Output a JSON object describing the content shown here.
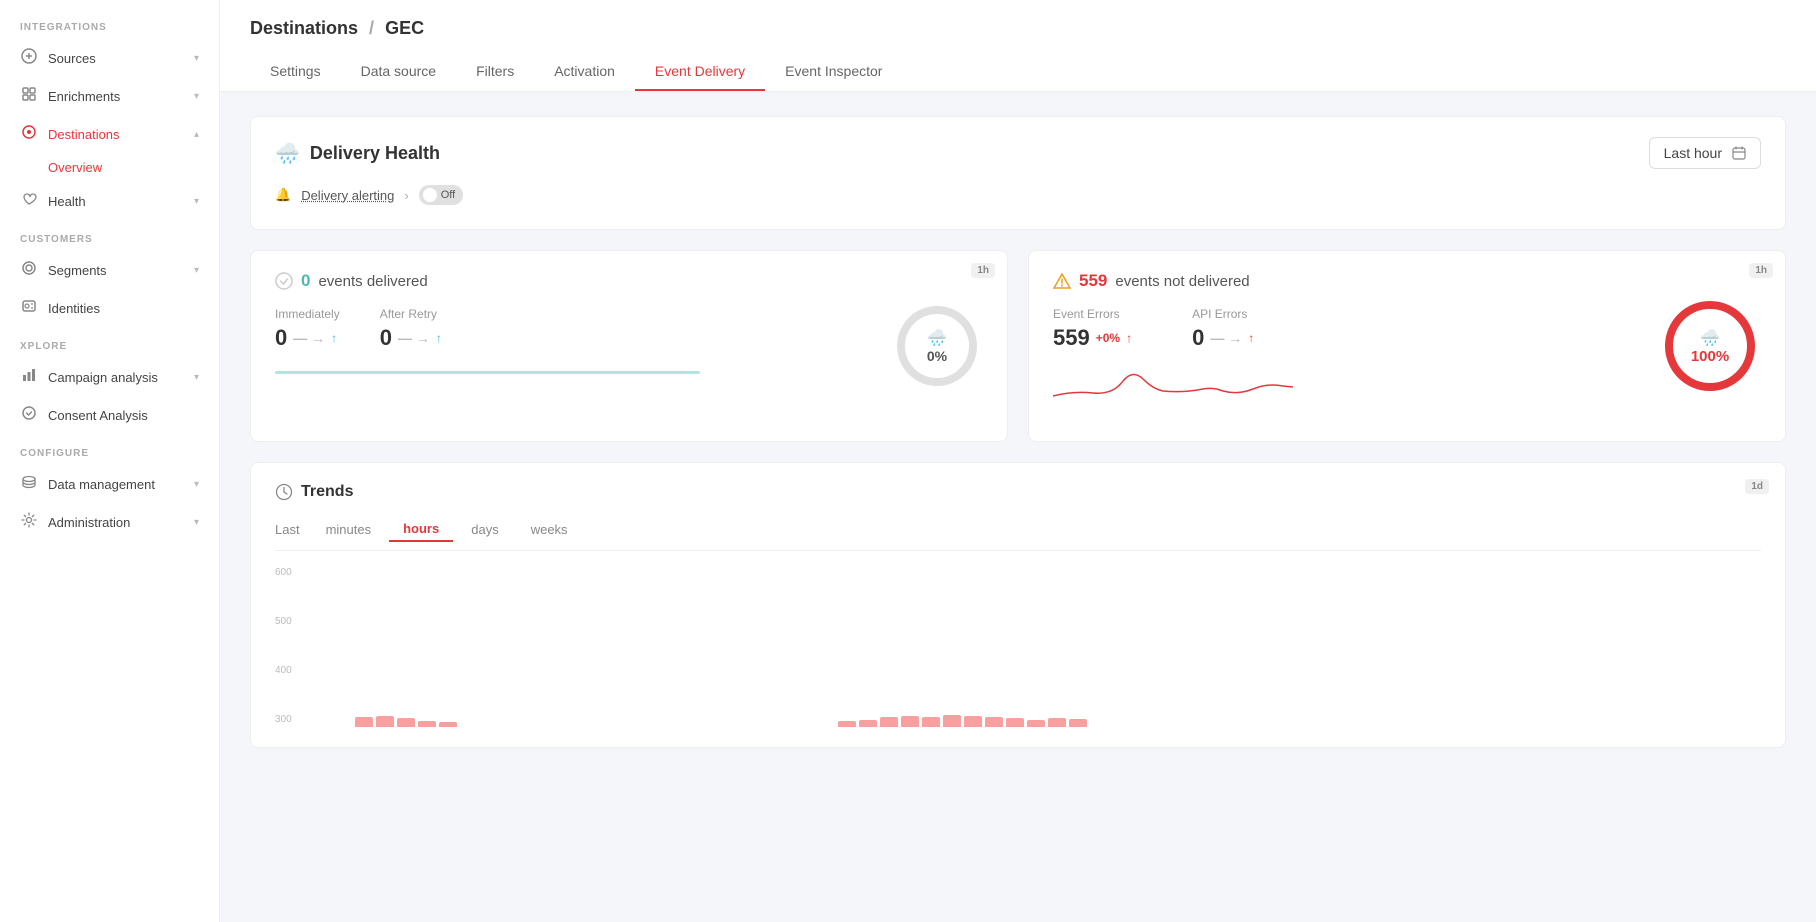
{
  "sidebar": {
    "integrations_label": "INTEGRATIONS",
    "customers_label": "CUSTOMERS",
    "explore_label": "XPLORE",
    "configure_label": "CONFIGURE",
    "items": [
      {
        "label": "Sources",
        "icon": "→",
        "expandable": true,
        "active": false
      },
      {
        "label": "Enrichments",
        "icon": "✦",
        "expandable": true,
        "active": false
      },
      {
        "label": "Destinations",
        "icon": "◎",
        "expandable": true,
        "active": true
      },
      {
        "label": "Overview",
        "icon": "",
        "sub": true,
        "active": true
      },
      {
        "label": "Health",
        "icon": "♡",
        "expandable": true,
        "active": false
      },
      {
        "label": "Segments",
        "icon": "⊙",
        "expandable": true,
        "active": false
      },
      {
        "label": "Identities",
        "icon": "◈",
        "expandable": false,
        "active": false
      },
      {
        "label": "Campaign analysis",
        "icon": "📊",
        "expandable": true,
        "active": false
      },
      {
        "label": "Consent Analysis",
        "icon": "⊕",
        "expandable": false,
        "active": false
      },
      {
        "label": "Data management",
        "icon": "🗄",
        "expandable": true,
        "active": false
      },
      {
        "label": "Administration",
        "icon": "⚙",
        "expandable": true,
        "active": false
      }
    ]
  },
  "breadcrumb": {
    "parent": "Destinations",
    "separator": "/",
    "current": "GEC"
  },
  "tabs": [
    {
      "label": "Settings",
      "active": false
    },
    {
      "label": "Data source",
      "active": false
    },
    {
      "label": "Filters",
      "active": false
    },
    {
      "label": "Activation",
      "active": false
    },
    {
      "label": "Event Delivery",
      "active": true
    },
    {
      "label": "Event Inspector",
      "active": false
    }
  ],
  "delivery_health": {
    "title": "Delivery Health",
    "time_selector": "Last hour",
    "alerting_label": "Delivery alerting",
    "toggle_label": "Off"
  },
  "events_delivered": {
    "badge": "1h",
    "title_prefix": "",
    "count": "0",
    "title_suffix": "events delivered",
    "immediately_label": "Immediately",
    "immediately_value": "0",
    "after_retry_label": "After Retry",
    "after_retry_value": "0",
    "percent": "0%"
  },
  "events_not_delivered": {
    "badge": "1h",
    "count": "559",
    "title_suffix": "events not delivered",
    "event_errors_label": "Event Errors",
    "event_errors_value": "559",
    "event_errors_badge": "+0%",
    "api_errors_label": "API Errors",
    "api_errors_value": "0",
    "percent": "100%"
  },
  "trends": {
    "title": "Trends",
    "badge": "1d",
    "time_prefix": "Last",
    "tabs": [
      "minutes",
      "hours",
      "days",
      "weeks"
    ],
    "active_tab": "hours",
    "y_axis": [
      "600",
      "500",
      "400",
      "300"
    ],
    "bars": [
      38,
      42,
      32,
      24,
      18,
      0,
      0,
      0,
      0,
      0,
      0,
      0,
      0,
      0,
      0,
      0,
      0,
      0,
      0,
      0,
      0,
      0,
      0,
      22,
      28,
      38,
      42,
      36,
      44,
      40,
      38,
      32,
      28,
      35,
      30
    ]
  }
}
